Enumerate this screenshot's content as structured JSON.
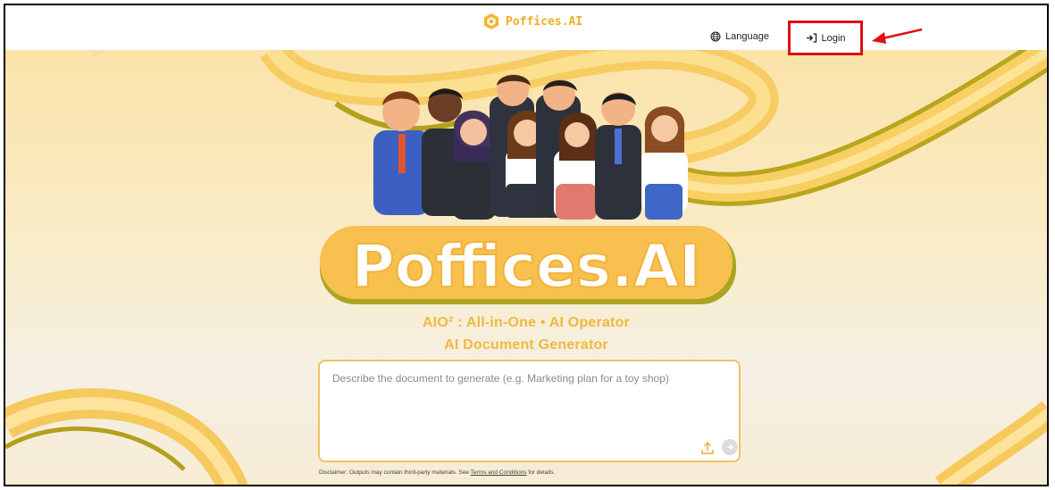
{
  "header": {
    "brand_name": "Poffices.AI",
    "language_label": "Language",
    "login_label": "Login",
    "logo_icon": "poffices-logo-icon",
    "language_icon": "globe-icon",
    "login_icon": "login-arrow-icon",
    "annotation_icon": "red-arrow-icon",
    "highlight_color": "#e01010"
  },
  "hero": {
    "title": "Poffices.AI",
    "subtitle_line1": "AIO² : All-in-One • AI Operator",
    "subtitle_line2": "AI Document Generator",
    "illustration_icon": "business-team-illustration",
    "accent_color": "#f0b93e"
  },
  "prompt": {
    "placeholder": "Describe the document to generate (e.g. Marketing plan for a toy shop)",
    "value": "",
    "upload_icon": "upload-icon",
    "send_icon": "send-arrow-icon"
  },
  "disclaimer": {
    "prefix": "Disclaimer: Outputs may contain third-party materials. See",
    "link_text": "Terms and Conditions",
    "suffix": "for details."
  }
}
